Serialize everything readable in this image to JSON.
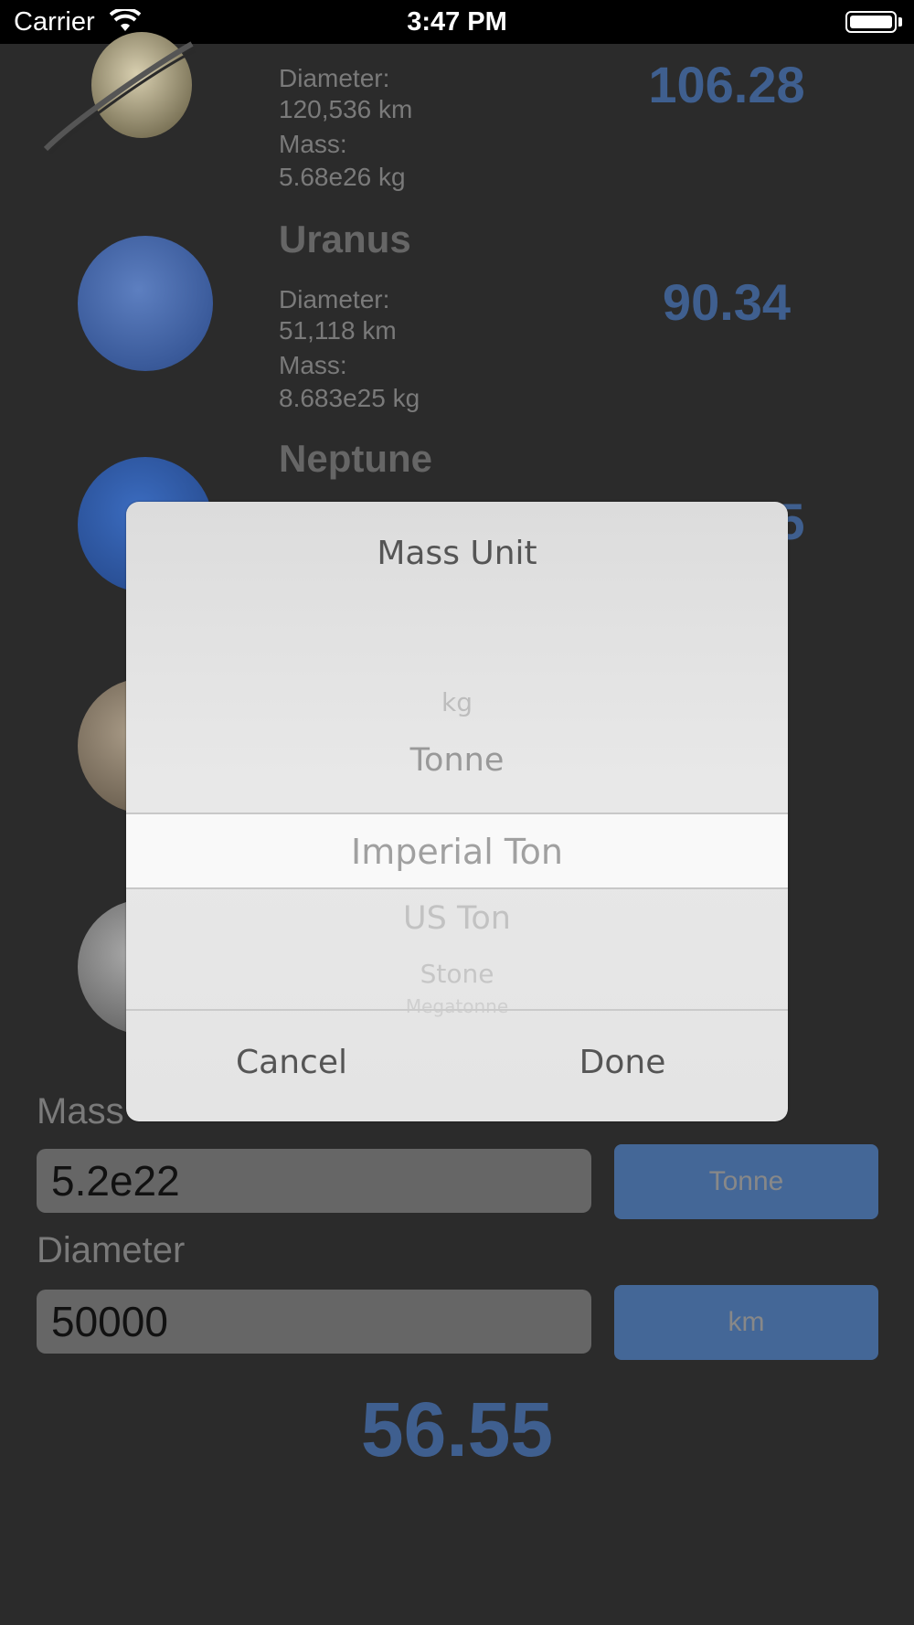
{
  "status_bar": {
    "carrier": "Carrier",
    "time": "3:47 PM"
  },
  "planets": [
    {
      "name": "",
      "diameter_label": "Diameter:",
      "diameter_value": "120,536 km",
      "mass_label": "Mass:",
      "mass_value": "5.68e26 kg",
      "weight": "106.28"
    },
    {
      "name": "Uranus",
      "diameter_label": "Diameter:",
      "diameter_value": "51,118 km",
      "mass_label": "Mass:",
      "mass_value": "8.683e25 kg",
      "weight": "90.34"
    },
    {
      "name": "Neptune",
      "weight_partial": "5"
    }
  ],
  "form": {
    "mass_label": "Mass",
    "mass_value": "5.2e22",
    "mass_unit_button": "Tonne",
    "diameter_label": "Diameter",
    "diameter_value": "50000",
    "diameter_unit_button": "km",
    "result": "56.55"
  },
  "dialog": {
    "title": "Mass Unit",
    "options": [
      "kg",
      "Tonne",
      "Imperial Ton",
      "US Ton",
      "Stone",
      "Megatonne"
    ],
    "selected": "Imperial Ton",
    "cancel_label": "Cancel",
    "done_label": "Done"
  },
  "colors": {
    "background": "#2b2b2b",
    "accent_blue": "#3f5f8f",
    "button_blue": "#446797"
  }
}
